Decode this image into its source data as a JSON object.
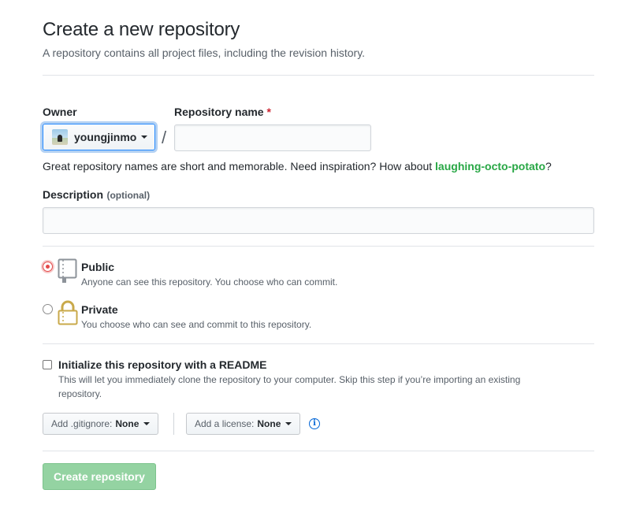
{
  "header": {
    "title": "Create a new repository",
    "subtitle": "A repository contains all project files, including the revision history."
  },
  "owner": {
    "label": "Owner",
    "selected": "youngjinmo"
  },
  "repo_name": {
    "label": "Repository name",
    "required_marker": "*",
    "value": "",
    "separator": "/"
  },
  "hint": {
    "text": "Great repository names are short and memorable. Need inspiration? How about ",
    "suggestion": "laughing-octo-potato",
    "suffix": "?"
  },
  "description": {
    "label": "Description",
    "optional": "(optional)",
    "value": ""
  },
  "visibility": {
    "selected": "public",
    "options": [
      {
        "title": "Public",
        "desc": "Anyone can see this repository. You choose who can commit."
      },
      {
        "title": "Private",
        "desc": "You choose who can see and commit to this repository."
      }
    ]
  },
  "readme": {
    "checked": false,
    "title": "Initialize this repository with a README",
    "desc_line1": "This will let you immediately clone the repository to your computer. Skip this step if you’re importing an existing",
    "desc_line2": "repository."
  },
  "gitignore": {
    "label": "Add .gitignore:",
    "value": "None"
  },
  "license": {
    "label": "Add a license:",
    "value": "None"
  },
  "info_icon_glyph": "i",
  "submit": {
    "label": "Create repository",
    "enabled": false
  },
  "colors": {
    "accent_green": "#28a745",
    "submit_disabled": "#94d3a2",
    "required_red": "#cb2431",
    "radio_selected": "#e34a4a",
    "focus_blue": "#2188ff"
  }
}
